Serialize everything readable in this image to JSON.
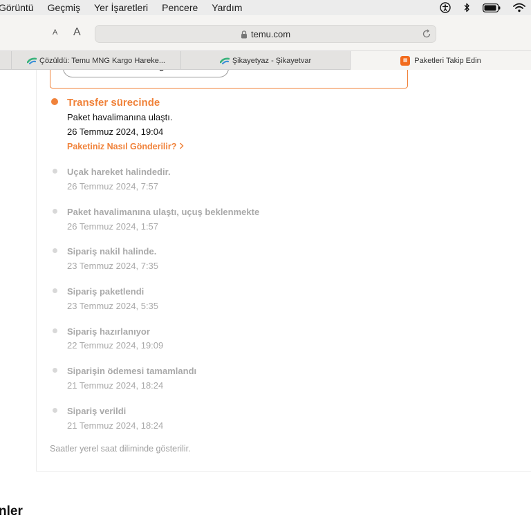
{
  "menubar": {
    "items": [
      "Görüntü",
      "Geçmiş",
      "Yer İşaretleri",
      "Pencere",
      "Yardım"
    ],
    "status_icons": [
      "accessibility-icon",
      "bluetooth-icon",
      "battery-icon",
      "wifi-icon"
    ]
  },
  "toolbar": {
    "font_small": "A",
    "font_large": "A",
    "url": "temu.com"
  },
  "tabs": [
    {
      "label": "Çözüldü: Temu MNG Kargo Hareke...",
      "icon": "sikayetvar-icon",
      "active": false
    },
    {
      "label": "Şikayetyaz - Şikayetvar",
      "icon": "sikayetvar-icon",
      "active": false
    },
    {
      "label": "Paketleri Takip Edin",
      "icon": "temu-icon",
      "active": true
    }
  ],
  "page": {
    "partial_button": "Gönderi bilgileri",
    "current_event": {
      "title": "Transfer sürecinde",
      "description": "Paket havalimanına ulaştı.",
      "date": "26 Temmuz 2024, 19:04",
      "link": "Paketiniz Nasıl Gönderilir?"
    },
    "events": [
      {
        "title": "Uçak hareket halindedir.",
        "date": "26 Temmuz 2024, 7:57"
      },
      {
        "title": "Paket havalimanına ulaştı, uçuş beklenmekte",
        "date": "26 Temmuz 2024, 1:57"
      },
      {
        "title": "Sipariş nakil halinde.",
        "date": "23 Temmuz 2024, 7:35"
      },
      {
        "title": "Sipariş paketlendi",
        "date": "23 Temmuz 2024, 5:35"
      },
      {
        "title": "Sipariş hazırlanıyor",
        "date": "22 Temmuz 2024, 19:09"
      },
      {
        "title": "Siparişin ödemesi tamamlandı",
        "date": "21 Temmuz 2024, 18:24"
      },
      {
        "title": "Sipariş verildi",
        "date": "21 Temmuz 2024, 18:24"
      }
    ],
    "footnote": "Saatler yerel saat diliminde gösterilir.",
    "bottom_heading": "nler"
  },
  "colors": {
    "accent": "#f0823a",
    "inactive_text": "#a9a9a9"
  }
}
